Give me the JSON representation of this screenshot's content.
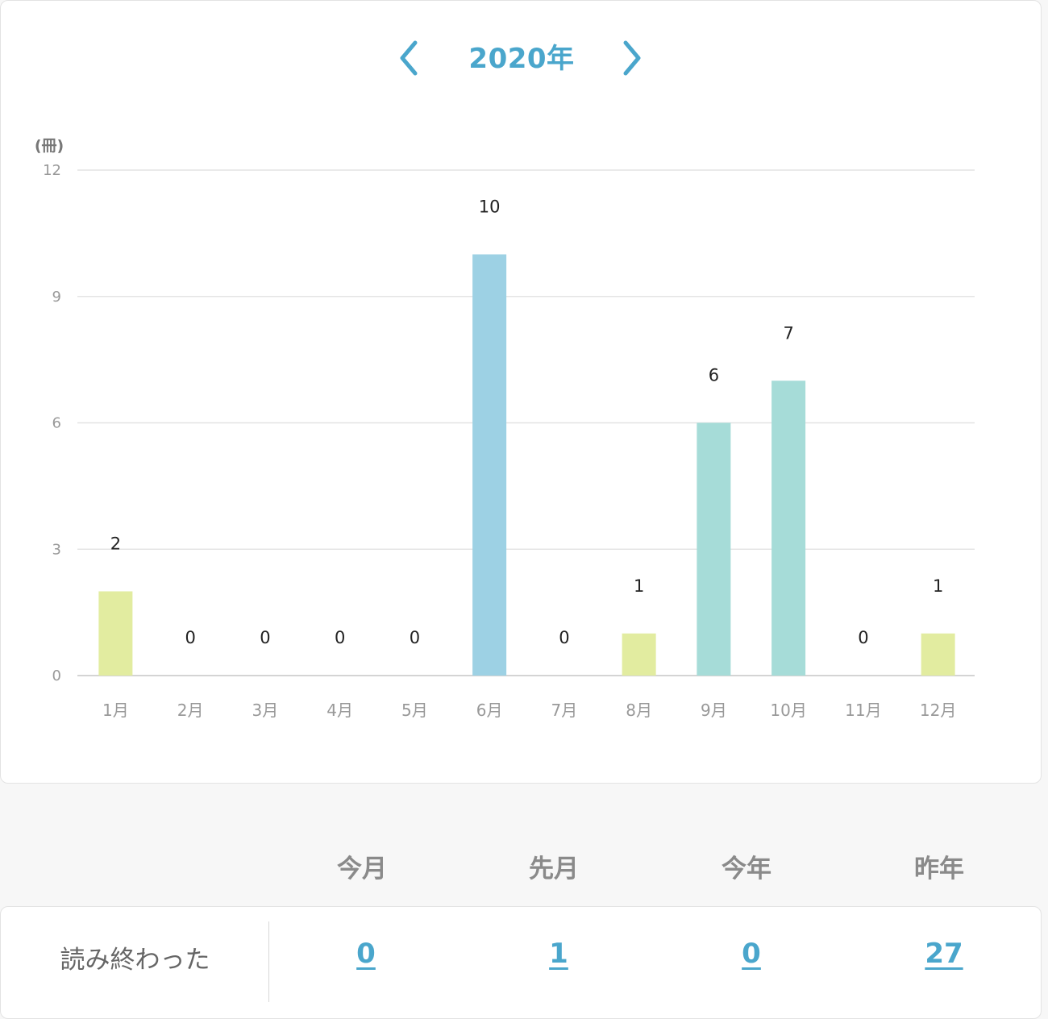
{
  "header": {
    "year_title": "2020年",
    "prev_icon": "chevron-left-icon",
    "next_icon": "chevron-right-icon",
    "accent_color": "#4aa6cc"
  },
  "chart_data": {
    "type": "bar",
    "unit_label": "(冊)",
    "categories": [
      "1月",
      "2月",
      "3月",
      "4月",
      "5月",
      "6月",
      "7月",
      "8月",
      "9月",
      "10月",
      "11月",
      "12月"
    ],
    "values": [
      2,
      0,
      0,
      0,
      0,
      10,
      0,
      1,
      6,
      7,
      0,
      1
    ],
    "bar_colors": [
      "#e2eca0",
      "#e2eca0",
      "#e2eca0",
      "#e2eca0",
      "#e2eca0",
      "#9dd1e4",
      "#e2eca0",
      "#e2eca0",
      "#a6dcd8",
      "#a6dcd8",
      "#e2eca0",
      "#e2eca0"
    ],
    "ylim": [
      0,
      12
    ],
    "yticks": [
      0,
      3,
      6,
      9,
      12
    ],
    "grid": true,
    "show_data_labels": true
  },
  "summary": {
    "columns": [
      "今月",
      "先月",
      "今年",
      "昨年"
    ],
    "row_label": "読み終わった",
    "values": [
      "0",
      "1",
      "0",
      "27"
    ]
  }
}
